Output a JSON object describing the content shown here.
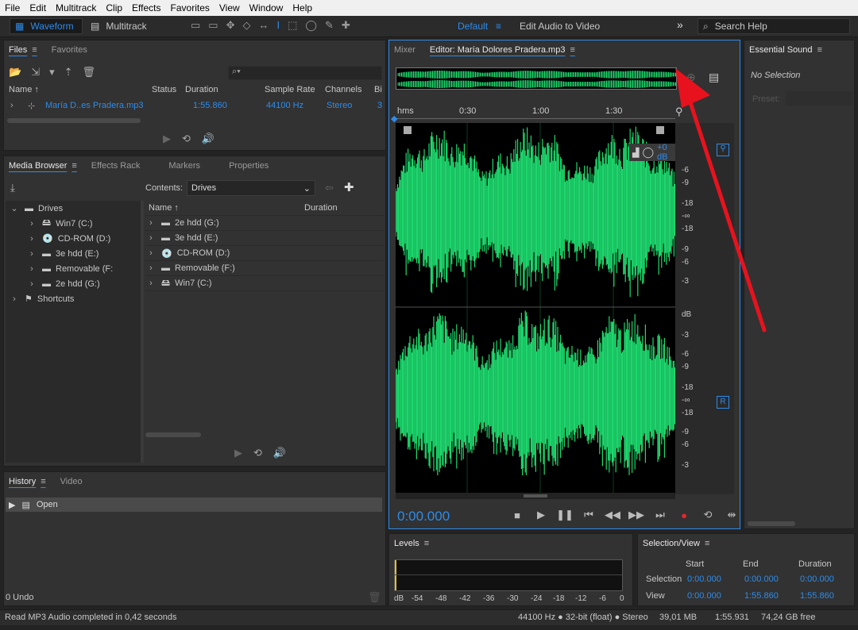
{
  "menu": [
    "File",
    "Edit",
    "Multitrack",
    "Clip",
    "Effects",
    "Favorites",
    "View",
    "Window",
    "Help"
  ],
  "toolbar": {
    "waveform": "Waveform",
    "multitrack": "Multitrack",
    "workspace": "Default",
    "edit_audio_video": "Edit Audio to Video",
    "search": "Search Help"
  },
  "files": {
    "tabs": [
      "Files",
      "Favorites"
    ],
    "cols": [
      "Name",
      "Status",
      "Duration",
      "Sample Rate",
      "Channels",
      "Bi"
    ],
    "row": {
      "name": "María D..es Pradera.mp3",
      "duration": "1:55.860",
      "rate": "44100 Hz",
      "channels": "Stereo",
      "bits": "3"
    }
  },
  "media": {
    "tabs": [
      "Media Browser",
      "Effects Rack",
      "Markers",
      "Properties"
    ],
    "contents_label": "Contents:",
    "contents_value": "Drives",
    "tree": [
      "Drives",
      "Win7 (C:)",
      "CD-ROM (D:)",
      "3e hdd (E:)",
      "Removable (F:",
      "2e hdd (G:)",
      "Shortcuts"
    ],
    "list_cols": [
      "Name",
      "Duration"
    ],
    "list": [
      "2e hdd (G:)",
      "3e hdd (E:)",
      "CD-ROM (D:)",
      "Removable (F:)",
      "Win7 (C:)"
    ]
  },
  "history": {
    "tabs": [
      "History",
      "Video"
    ],
    "item": "Open",
    "undo": "0 Undo"
  },
  "editor": {
    "tabs": [
      "Mixer",
      "Editor: María Dolores Pradera.mp3"
    ],
    "ruler": [
      "hms",
      "0:30",
      "1:00",
      "1:30"
    ],
    "db_top": [
      "-6",
      "-9",
      "-18",
      "-∞",
      "-18",
      "-9",
      "-6",
      "-3"
    ],
    "db_bottom": [
      "dB",
      "-3",
      "-6",
      "-9",
      "-18",
      "-∞",
      "-18",
      "-9",
      "-6",
      "-3"
    ],
    "hud": "+0 dB",
    "channel_r": "R",
    "time": "0:00.000"
  },
  "essential": {
    "title": "Essential Sound",
    "no_selection": "No Selection",
    "preset": "Preset:"
  },
  "levels": {
    "title": "Levels",
    "scale": [
      "dB",
      "-54",
      "-48",
      "-42",
      "-36",
      "-30",
      "-24",
      "-18",
      "-12",
      "-6",
      "0"
    ]
  },
  "selection": {
    "title": "Selection/View",
    "cols": [
      "Start",
      "End",
      "Duration"
    ],
    "rows": [
      {
        "label": "Selection",
        "start": "0:00.000",
        "end": "0:00.000",
        "dur": "0:00.000"
      },
      {
        "label": "View",
        "start": "0:00.000",
        "end": "1:55.860",
        "dur": "1:55.860"
      }
    ]
  },
  "status": {
    "left": "Read MP3 Audio completed in 0,42 seconds",
    "format": "44100 Hz ● 32-bit (float) ● Stereo",
    "size": "39,01 MB",
    "dur": "1:55.931",
    "free": "74,24 GB free"
  },
  "colors": {
    "accent": "#2d8ceb",
    "wave": "#1ed76d",
    "record": "#e8262c",
    "annotation_arrow": "#e8121e"
  }
}
